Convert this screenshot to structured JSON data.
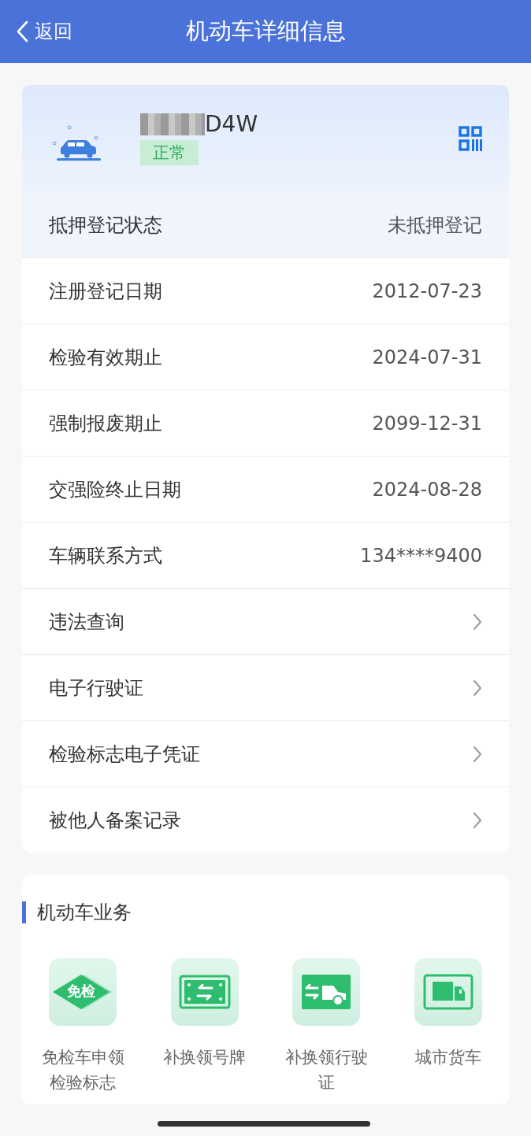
{
  "nav": {
    "back": "返回",
    "title": "机动车详细信息"
  },
  "vehicle": {
    "plate_masked": true,
    "plate": "D4W",
    "status": "正常"
  },
  "rows": [
    {
      "kind": "value",
      "label": "抵押登记状态",
      "value": "未抵押登记"
    },
    {
      "kind": "value",
      "label": "注册登记日期",
      "value": "2012-07-23"
    },
    {
      "kind": "value",
      "label": "检验有效期止",
      "value": "2024-07-31"
    },
    {
      "kind": "value",
      "label": "强制报废期止",
      "value": "2099-12-31"
    },
    {
      "kind": "value",
      "label": "交强险终止日期",
      "value": "2024-08-28"
    },
    {
      "kind": "value",
      "label": "车辆联系方式",
      "value": "134****9400"
    },
    {
      "kind": "link",
      "label": "违法查询"
    },
    {
      "kind": "link",
      "label": "电子行驶证"
    },
    {
      "kind": "link",
      "label": "检验标志电子凭证"
    },
    {
      "kind": "link",
      "label": "被他人备案记录"
    }
  ],
  "services": {
    "title": "机动车业务",
    "items": [
      {
        "kind": "exempt",
        "icon_text": "免检",
        "label": "免检车申领检验标志"
      },
      {
        "kind": "plate",
        "label": "补换领号牌"
      },
      {
        "kind": "license",
        "label": "补换领行驶证"
      },
      {
        "kind": "truck",
        "label": "城市货车"
      }
    ]
  }
}
